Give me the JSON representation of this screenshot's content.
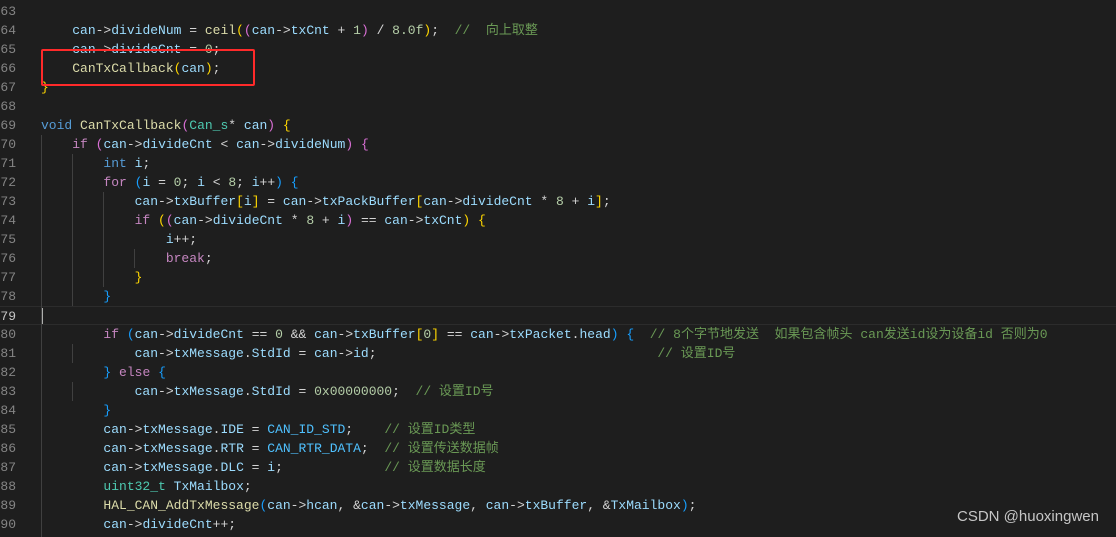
{
  "editor": {
    "first_line_number": 63,
    "current_line_number": 79,
    "lines": [
      [],
      [
        [
          "p",
          "    "
        ],
        [
          "v",
          "can"
        ],
        [
          "p",
          "->"
        ],
        [
          "v",
          "divideNum"
        ],
        [
          "p",
          " = "
        ],
        [
          "f",
          "ceil"
        ],
        [
          "b1",
          "("
        ],
        [
          "b2",
          "("
        ],
        [
          "v",
          "can"
        ],
        [
          "p",
          "->"
        ],
        [
          "v",
          "txCnt"
        ],
        [
          "p",
          " + "
        ],
        [
          "n",
          "1"
        ],
        [
          "b2",
          ")"
        ],
        [
          "p",
          " / "
        ],
        [
          "n",
          "8.0f"
        ],
        [
          "b1",
          ")"
        ],
        [
          "p",
          ";  "
        ],
        [
          "c",
          "//  向上取整"
        ]
      ],
      [
        [
          "p",
          "    "
        ],
        [
          "v",
          "can"
        ],
        [
          "p",
          "->"
        ],
        [
          "v",
          "divideCnt"
        ],
        [
          "p",
          " = "
        ],
        [
          "n",
          "0"
        ],
        [
          "p",
          ";"
        ]
      ],
      [
        [
          "p",
          "    "
        ],
        [
          "f",
          "CanTxCallback"
        ],
        [
          "b1",
          "("
        ],
        [
          "v",
          "can"
        ],
        [
          "b1",
          ")"
        ],
        [
          "p",
          ";"
        ]
      ],
      [
        [
          "b1",
          "}"
        ]
      ],
      [],
      [
        [
          "t",
          "void"
        ],
        [
          "p",
          " "
        ],
        [
          "f",
          "CanTxCallback"
        ],
        [
          "b2",
          "("
        ],
        [
          "ty",
          "Can_s"
        ],
        [
          "p",
          "* "
        ],
        [
          "v",
          "can"
        ],
        [
          "b2",
          ")"
        ],
        [
          "p",
          " "
        ],
        [
          "b1",
          "{"
        ]
      ],
      [
        [
          "p",
          "    "
        ],
        [
          "k",
          "if"
        ],
        [
          "p",
          " "
        ],
        [
          "b2",
          "("
        ],
        [
          "v",
          "can"
        ],
        [
          "p",
          "->"
        ],
        [
          "v",
          "divideCnt"
        ],
        [
          "p",
          " < "
        ],
        [
          "v",
          "can"
        ],
        [
          "p",
          "->"
        ],
        [
          "v",
          "divideNum"
        ],
        [
          "b2",
          ")"
        ],
        [
          "p",
          " "
        ],
        [
          "b2",
          "{"
        ]
      ],
      [
        [
          "p",
          "        "
        ],
        [
          "t",
          "int"
        ],
        [
          "p",
          " "
        ],
        [
          "v",
          "i"
        ],
        [
          "p",
          ";"
        ]
      ],
      [
        [
          "p",
          "        "
        ],
        [
          "k",
          "for"
        ],
        [
          "p",
          " "
        ],
        [
          "b3",
          "("
        ],
        [
          "v",
          "i"
        ],
        [
          "p",
          " = "
        ],
        [
          "n",
          "0"
        ],
        [
          "p",
          "; "
        ],
        [
          "v",
          "i"
        ],
        [
          "p",
          " < "
        ],
        [
          "n",
          "8"
        ],
        [
          "p",
          "; "
        ],
        [
          "v",
          "i"
        ],
        [
          "p",
          "++"
        ],
        [
          "b3",
          ")"
        ],
        [
          "p",
          " "
        ],
        [
          "b3",
          "{"
        ]
      ],
      [
        [
          "p",
          "            "
        ],
        [
          "v",
          "can"
        ],
        [
          "p",
          "->"
        ],
        [
          "v",
          "txBuffer"
        ],
        [
          "b1",
          "["
        ],
        [
          "v",
          "i"
        ],
        [
          "b1",
          "]"
        ],
        [
          "p",
          " = "
        ],
        [
          "v",
          "can"
        ],
        [
          "p",
          "->"
        ],
        [
          "v",
          "txPackBuffer"
        ],
        [
          "b1",
          "["
        ],
        [
          "v",
          "can"
        ],
        [
          "p",
          "->"
        ],
        [
          "v",
          "divideCnt"
        ],
        [
          "p",
          " * "
        ],
        [
          "n",
          "8"
        ],
        [
          "p",
          " + "
        ],
        [
          "v",
          "i"
        ],
        [
          "b1",
          "]"
        ],
        [
          "p",
          ";"
        ]
      ],
      [
        [
          "p",
          "            "
        ],
        [
          "k",
          "if"
        ],
        [
          "p",
          " "
        ],
        [
          "b1",
          "("
        ],
        [
          "b2",
          "("
        ],
        [
          "v",
          "can"
        ],
        [
          "p",
          "->"
        ],
        [
          "v",
          "divideCnt"
        ],
        [
          "p",
          " * "
        ],
        [
          "n",
          "8"
        ],
        [
          "p",
          " + "
        ],
        [
          "v",
          "i"
        ],
        [
          "b2",
          ")"
        ],
        [
          "p",
          " == "
        ],
        [
          "v",
          "can"
        ],
        [
          "p",
          "->"
        ],
        [
          "v",
          "txCnt"
        ],
        [
          "b1",
          ")"
        ],
        [
          "p",
          " "
        ],
        [
          "b1",
          "{"
        ]
      ],
      [
        [
          "p",
          "                "
        ],
        [
          "v",
          "i"
        ],
        [
          "p",
          "++;"
        ]
      ],
      [
        [
          "p",
          "                "
        ],
        [
          "k",
          "break"
        ],
        [
          "p",
          ";"
        ]
      ],
      [
        [
          "p",
          "            "
        ],
        [
          "b1",
          "}"
        ]
      ],
      [
        [
          "p",
          "        "
        ],
        [
          "b3",
          "}"
        ]
      ],
      [],
      [
        [
          "p",
          "        "
        ],
        [
          "k",
          "if"
        ],
        [
          "p",
          " "
        ],
        [
          "b3",
          "("
        ],
        [
          "v",
          "can"
        ],
        [
          "p",
          "->"
        ],
        [
          "v",
          "divideCnt"
        ],
        [
          "p",
          " == "
        ],
        [
          "n",
          "0"
        ],
        [
          "p",
          " && "
        ],
        [
          "v",
          "can"
        ],
        [
          "p",
          "->"
        ],
        [
          "v",
          "txBuffer"
        ],
        [
          "b1",
          "["
        ],
        [
          "n",
          "0"
        ],
        [
          "b1",
          "]"
        ],
        [
          "p",
          " == "
        ],
        [
          "v",
          "can"
        ],
        [
          "p",
          "->"
        ],
        [
          "v",
          "txPacket"
        ],
        [
          "p",
          "."
        ],
        [
          "v",
          "head"
        ],
        [
          "b3",
          ")"
        ],
        [
          "p",
          " "
        ],
        [
          "b3",
          "{"
        ],
        [
          "p",
          "  "
        ],
        [
          "c",
          "// 8个字节地发送  如果包含帧头 can发送id设为设备id 否则为0"
        ]
      ],
      [
        [
          "p",
          "            "
        ],
        [
          "v",
          "can"
        ],
        [
          "p",
          "->"
        ],
        [
          "v",
          "txMessage"
        ],
        [
          "p",
          "."
        ],
        [
          "v",
          "StdId"
        ],
        [
          "p",
          " = "
        ],
        [
          "v",
          "can"
        ],
        [
          "p",
          "->"
        ],
        [
          "v",
          "id"
        ],
        [
          "p",
          ";                                    "
        ],
        [
          "c",
          "// 设置ID号"
        ]
      ],
      [
        [
          "p",
          "        "
        ],
        [
          "b3",
          "}"
        ],
        [
          "p",
          " "
        ],
        [
          "k",
          "else"
        ],
        [
          "p",
          " "
        ],
        [
          "b3",
          "{"
        ]
      ],
      [
        [
          "p",
          "            "
        ],
        [
          "v",
          "can"
        ],
        [
          "p",
          "->"
        ],
        [
          "v",
          "txMessage"
        ],
        [
          "p",
          "."
        ],
        [
          "v",
          "StdId"
        ],
        [
          "p",
          " = "
        ],
        [
          "n",
          "0x00000000"
        ],
        [
          "p",
          ";  "
        ],
        [
          "c",
          "// 设置ID号"
        ]
      ],
      [
        [
          "p",
          "        "
        ],
        [
          "b3",
          "}"
        ]
      ],
      [
        [
          "p",
          "        "
        ],
        [
          "v",
          "can"
        ],
        [
          "p",
          "->"
        ],
        [
          "v",
          "txMessage"
        ],
        [
          "p",
          "."
        ],
        [
          "v",
          "IDE"
        ],
        [
          "p",
          " = "
        ],
        [
          "m",
          "CAN_ID_STD"
        ],
        [
          "p",
          ";    "
        ],
        [
          "c",
          "// 设置ID类型"
        ]
      ],
      [
        [
          "p",
          "        "
        ],
        [
          "v",
          "can"
        ],
        [
          "p",
          "->"
        ],
        [
          "v",
          "txMessage"
        ],
        [
          "p",
          "."
        ],
        [
          "v",
          "RTR"
        ],
        [
          "p",
          " = "
        ],
        [
          "m",
          "CAN_RTR_DATA"
        ],
        [
          "p",
          ";  "
        ],
        [
          "c",
          "// 设置传送数据帧"
        ]
      ],
      [
        [
          "p",
          "        "
        ],
        [
          "v",
          "can"
        ],
        [
          "p",
          "->"
        ],
        [
          "v",
          "txMessage"
        ],
        [
          "p",
          "."
        ],
        [
          "v",
          "DLC"
        ],
        [
          "p",
          " = "
        ],
        [
          "v",
          "i"
        ],
        [
          "p",
          ";             "
        ],
        [
          "c",
          "// 设置数据长度"
        ]
      ],
      [
        [
          "p",
          "        "
        ],
        [
          "ty",
          "uint32_t"
        ],
        [
          "p",
          " "
        ],
        [
          "v",
          "TxMailbox"
        ],
        [
          "p",
          ";"
        ]
      ],
      [
        [
          "p",
          "        "
        ],
        [
          "f",
          "HAL_CAN_AddTxMessage"
        ],
        [
          "b3",
          "("
        ],
        [
          "v",
          "can"
        ],
        [
          "p",
          "->"
        ],
        [
          "v",
          "hcan"
        ],
        [
          "p",
          ", &"
        ],
        [
          "v",
          "can"
        ],
        [
          "p",
          "->"
        ],
        [
          "v",
          "txMessage"
        ],
        [
          "p",
          ", "
        ],
        [
          "v",
          "can"
        ],
        [
          "p",
          "->"
        ],
        [
          "v",
          "txBuffer"
        ],
        [
          "p",
          ", &"
        ],
        [
          "v",
          "TxMailbox"
        ],
        [
          "b3",
          ")"
        ],
        [
          "p",
          ";"
        ]
      ],
      [
        [
          "p",
          "        "
        ],
        [
          "v",
          "can"
        ],
        [
          "p",
          "->"
        ],
        [
          "v",
          "divideCnt"
        ],
        [
          "p",
          "++;"
        ]
      ]
    ]
  },
  "annotation": {
    "color": "#ff2a2a"
  },
  "watermark": "CSDN @huoxingwen"
}
